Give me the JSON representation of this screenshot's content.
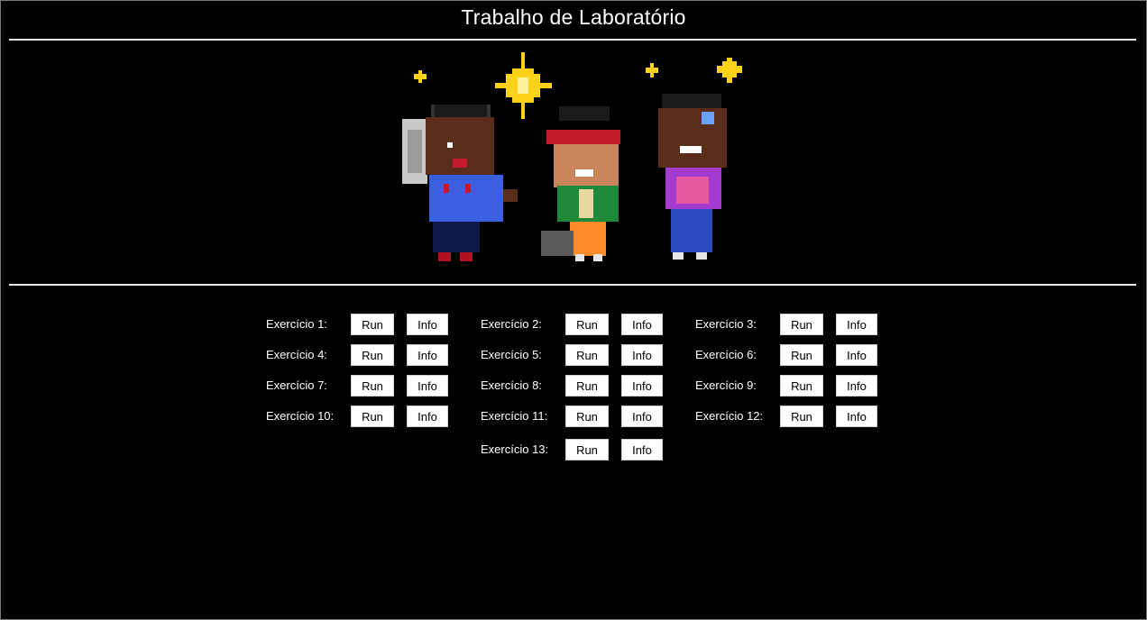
{
  "page": {
    "title": "Trabalho de Laboratório"
  },
  "exercises": [
    {
      "label": "Exercício 1:",
      "run": "Run",
      "info": "Info"
    },
    {
      "label": "Exercício 2:",
      "run": "Run",
      "info": "Info"
    },
    {
      "label": "Exercício 3:",
      "run": "Run",
      "info": "Info"
    },
    {
      "label": "Exercício 4:",
      "run": "Run",
      "info": "Info"
    },
    {
      "label": "Exercício 5:",
      "run": "Run",
      "info": "Info"
    },
    {
      "label": "Exercício 6:",
      "run": "Run",
      "info": "Info"
    },
    {
      "label": "Exercício 7:",
      "run": "Run",
      "info": "Info"
    },
    {
      "label": "Exercício 8:",
      "run": "Run",
      "info": "Info"
    },
    {
      "label": "Exercício 9:",
      "run": "Run",
      "info": "Info"
    },
    {
      "label": "Exercício 10:",
      "run": "Run",
      "info": "Info"
    },
    {
      "label": "Exercício 11:",
      "run": "Run",
      "info": "Info"
    },
    {
      "label": "Exercício 12:",
      "run": "Run",
      "info": "Info"
    },
    {
      "label": "Exercício 13:",
      "run": "Run",
      "info": "Info"
    }
  ],
  "colors": {
    "background": "#000000",
    "rule": "#e6e6e6",
    "button_bg": "#ffffff",
    "star": "#ffd21a"
  }
}
